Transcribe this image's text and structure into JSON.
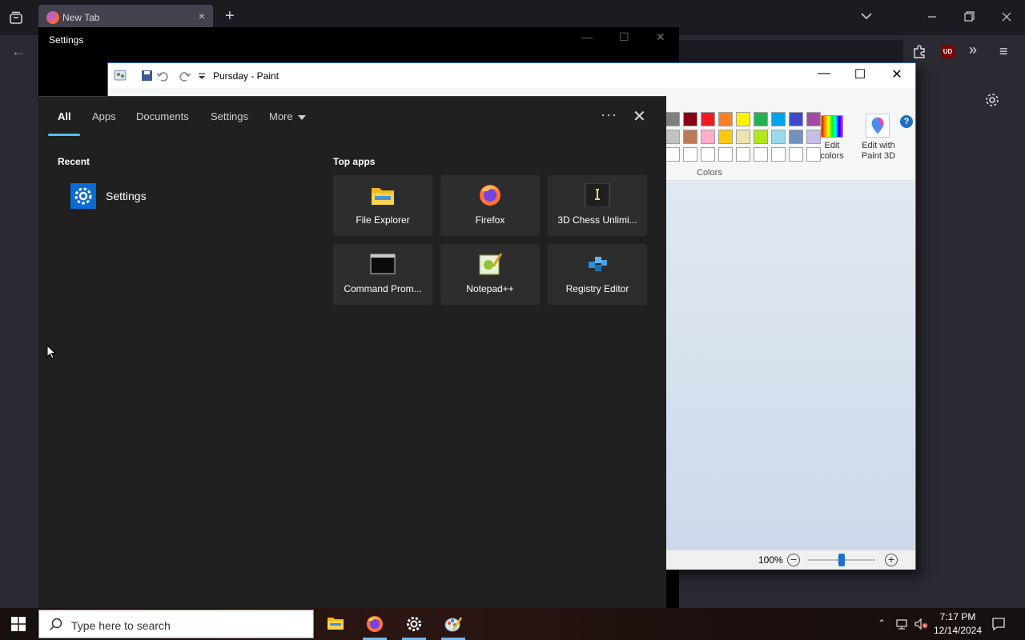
{
  "firefox": {
    "tab_title": "New Tab",
    "tab_close": "×",
    "new_tab": "+",
    "ublock_label": "UD"
  },
  "settings_window": {
    "title": "Settings"
  },
  "paint": {
    "title": "Pursday - Paint",
    "colors_label": "Colors",
    "edit_colors_label": "Edit colors",
    "edit_paint3d_label": "Edit with Paint 3D",
    "help": "?",
    "zoom_level": "100%",
    "palette_row1": [
      "#7f7f7f",
      "#880015",
      "#ed1c24",
      "#ff7f27",
      "#fff200",
      "#22b14c",
      "#00a2e8",
      "#3f48cc",
      "#a349a4"
    ],
    "palette_row2": [
      "#c3c3c3",
      "#b97a57",
      "#ffaec9",
      "#ffc90e",
      "#efe4b0",
      "#b5e61d",
      "#99d9ea",
      "#7092be",
      "#c8bfe7"
    ],
    "palette_row3": [
      "#ffffff",
      "#ffffff",
      "#ffffff",
      "#ffffff",
      "#ffffff",
      "#ffffff",
      "#ffffff",
      "#ffffff",
      "#ffffff"
    ]
  },
  "search_panel": {
    "tabs": {
      "all": "All",
      "apps": "Apps",
      "documents": "Documents",
      "settings": "Settings",
      "more": "More"
    },
    "dots": "···",
    "close": "✕",
    "recent_heading": "Recent",
    "recent_items": [
      {
        "label": "Settings",
        "icon": "settings-gear-icon"
      }
    ],
    "top_apps_heading": "Top apps",
    "top_apps": [
      {
        "label": "File Explorer",
        "icon": "file-explorer-icon"
      },
      {
        "label": "Firefox",
        "icon": "firefox-icon"
      },
      {
        "label": "3D Chess Unlimi...",
        "icon": "chess-icon"
      },
      {
        "label": "Command Prom...",
        "icon": "command-prompt-icon"
      },
      {
        "label": "Notepad++",
        "icon": "notepadpp-icon"
      },
      {
        "label": "Registry Editor",
        "icon": "registry-editor-icon"
      }
    ]
  },
  "taskbar": {
    "search_placeholder": "Type here to search",
    "apps": [
      {
        "name": "file-explorer",
        "icon": "file-explorer-icon",
        "active": false
      },
      {
        "name": "firefox",
        "icon": "firefox-icon",
        "active": true
      },
      {
        "name": "settings",
        "icon": "gear-icon",
        "active": true
      },
      {
        "name": "paint",
        "icon": "paint-icon",
        "active": true
      }
    ],
    "clock_time": "7:17 PM",
    "clock_date": "12/14/2024"
  }
}
